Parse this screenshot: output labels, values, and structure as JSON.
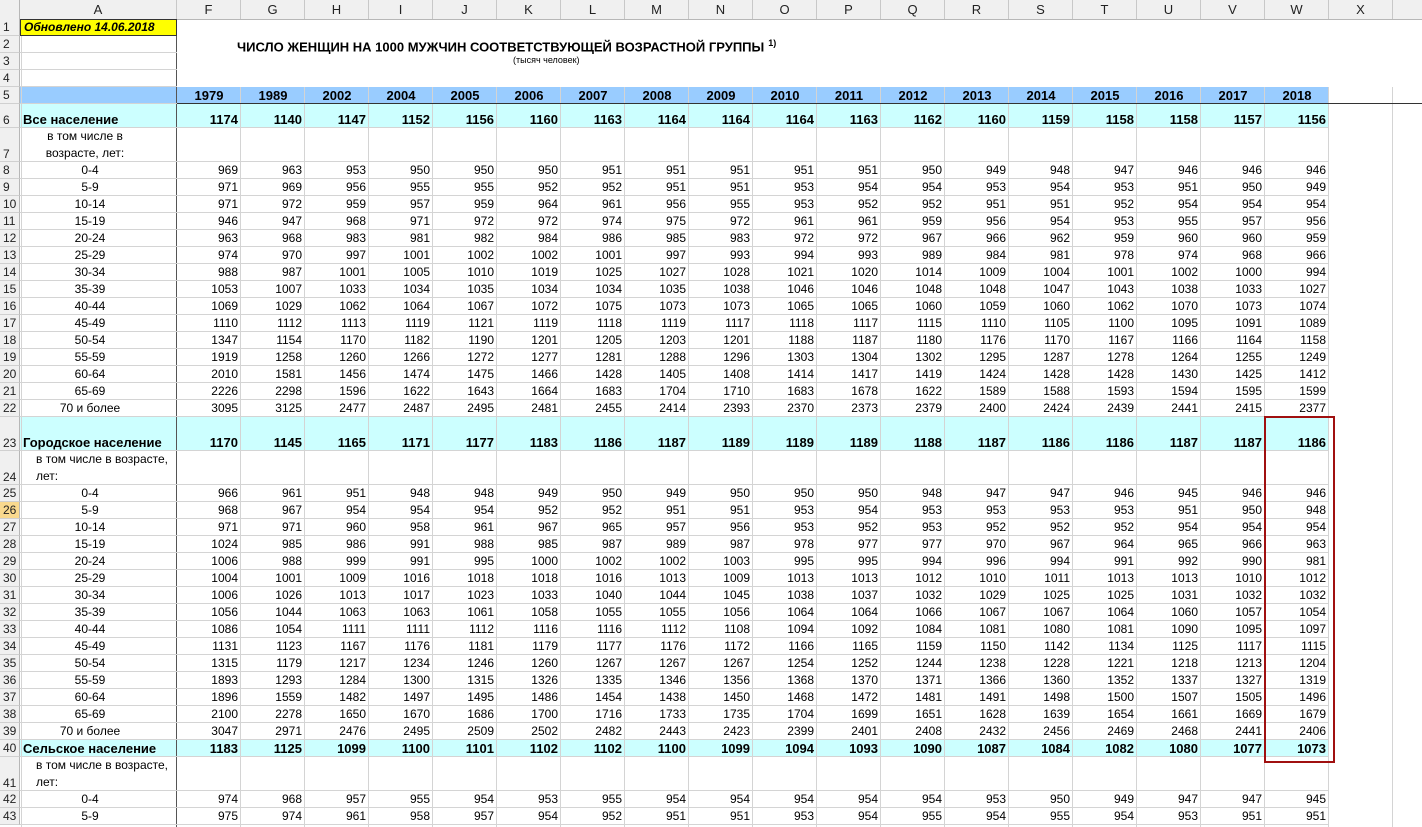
{
  "columns": [
    "A",
    "F",
    "G",
    "H",
    "I",
    "J",
    "K",
    "L",
    "M",
    "N",
    "O",
    "P",
    "Q",
    "R",
    "S",
    "T",
    "U",
    "V",
    "W",
    "X"
  ],
  "updated": "Обновлено 14.06.2018",
  "title": "ЧИСЛО ЖЕНЩИН НА 1000 МУЖЧИН СООТВЕТСТВУЮЩЕЙ ВОЗРАСТНОЙ ГРУППЫ",
  "title_note": "1)",
  "subtitle": "(тысяч человек)",
  "years": [
    "1979",
    "1989",
    "2002",
    "2004",
    "2005",
    "2006",
    "2007",
    "2008",
    "2009",
    "2010",
    "2011",
    "2012",
    "2013",
    "2014",
    "2015",
    "2016",
    "2017",
    "2018"
  ],
  "rows": [
    {
      "n": "6",
      "label": "Все население",
      "bold": true,
      "band": true,
      "values": [
        "1174",
        "1140",
        "1147",
        "1152",
        "1156",
        "1160",
        "1163",
        "1164",
        "1164",
        "1164",
        "1163",
        "1162",
        "1160",
        "1159",
        "1158",
        "1158",
        "1157",
        "1156"
      ]
    },
    {
      "n": "7",
      "label": "в том числе в возрасте, лет:",
      "subhead": true,
      "values": []
    },
    {
      "n": "8",
      "label": "0-4",
      "values": [
        "969",
        "963",
        "953",
        "950",
        "950",
        "950",
        "951",
        "951",
        "951",
        "951",
        "951",
        "950",
        "949",
        "948",
        "947",
        "946",
        "946",
        "946"
      ]
    },
    {
      "n": "9",
      "label": "5-9",
      "values": [
        "971",
        "969",
        "956",
        "955",
        "955",
        "952",
        "952",
        "951",
        "951",
        "953",
        "954",
        "954",
        "953",
        "954",
        "953",
        "951",
        "950",
        "949"
      ]
    },
    {
      "n": "10",
      "label": "10-14",
      "values": [
        "971",
        "972",
        "959",
        "957",
        "959",
        "964",
        "961",
        "956",
        "955",
        "953",
        "952",
        "952",
        "951",
        "951",
        "952",
        "954",
        "954",
        "954"
      ]
    },
    {
      "n": "11",
      "label": "15-19",
      "values": [
        "946",
        "947",
        "968",
        "971",
        "972",
        "972",
        "974",
        "975",
        "972",
        "961",
        "961",
        "959",
        "956",
        "954",
        "953",
        "955",
        "957",
        "956"
      ]
    },
    {
      "n": "12",
      "label": "20-24",
      "values": [
        "963",
        "968",
        "983",
        "981",
        "982",
        "984",
        "986",
        "985",
        "983",
        "972",
        "972",
        "967",
        "966",
        "962",
        "959",
        "960",
        "960",
        "959"
      ]
    },
    {
      "n": "13",
      "label": "25-29",
      "values": [
        "974",
        "970",
        "997",
        "1001",
        "1002",
        "1002",
        "1001",
        "997",
        "993",
        "994",
        "993",
        "989",
        "984",
        "981",
        "978",
        "974",
        "968",
        "966"
      ]
    },
    {
      "n": "14",
      "label": "30-34",
      "values": [
        "988",
        "987",
        "1001",
        "1005",
        "1010",
        "1019",
        "1025",
        "1027",
        "1028",
        "1021",
        "1020",
        "1014",
        "1009",
        "1004",
        "1001",
        "1002",
        "1000",
        "994"
      ]
    },
    {
      "n": "15",
      "label": "35-39",
      "values": [
        "1053",
        "1007",
        "1033",
        "1034",
        "1035",
        "1034",
        "1034",
        "1035",
        "1038",
        "1046",
        "1046",
        "1048",
        "1048",
        "1047",
        "1043",
        "1038",
        "1033",
        "1027"
      ]
    },
    {
      "n": "16",
      "label": "40-44",
      "values": [
        "1069",
        "1029",
        "1062",
        "1064",
        "1067",
        "1072",
        "1075",
        "1073",
        "1073",
        "1065",
        "1065",
        "1060",
        "1059",
        "1060",
        "1062",
        "1070",
        "1073",
        "1074"
      ]
    },
    {
      "n": "17",
      "label": "45-49",
      "values": [
        "1110",
        "1112",
        "1113",
        "1119",
        "1121",
        "1119",
        "1118",
        "1119",
        "1117",
        "1118",
        "1117",
        "1115",
        "1110",
        "1105",
        "1100",
        "1095",
        "1091",
        "1089"
      ]
    },
    {
      "n": "18",
      "label": "50-54",
      "values": [
        "1347",
        "1154",
        "1170",
        "1182",
        "1190",
        "1201",
        "1205",
        "1203",
        "1201",
        "1188",
        "1187",
        "1180",
        "1176",
        "1170",
        "1167",
        "1166",
        "1164",
        "1158"
      ]
    },
    {
      "n": "19",
      "label": "55-59",
      "values": [
        "1919",
        "1258",
        "1260",
        "1266",
        "1272",
        "1277",
        "1281",
        "1288",
        "1296",
        "1303",
        "1304",
        "1302",
        "1295",
        "1287",
        "1278",
        "1264",
        "1255",
        "1249"
      ]
    },
    {
      "n": "20",
      "label": "60-64",
      "values": [
        "2010",
        "1581",
        "1456",
        "1474",
        "1475",
        "1466",
        "1428",
        "1405",
        "1408",
        "1414",
        "1417",
        "1419",
        "1424",
        "1428",
        "1428",
        "1430",
        "1425",
        "1412"
      ]
    },
    {
      "n": "21",
      "label": "65-69",
      "values": [
        "2226",
        "2298",
        "1596",
        "1622",
        "1643",
        "1664",
        "1683",
        "1704",
        "1710",
        "1683",
        "1678",
        "1622",
        "1589",
        "1588",
        "1593",
        "1594",
        "1595",
        "1599"
      ]
    },
    {
      "n": "22",
      "label": "70 и более",
      "values": [
        "3095",
        "3125",
        "2477",
        "2487",
        "2495",
        "2481",
        "2455",
        "2414",
        "2393",
        "2370",
        "2373",
        "2379",
        "2400",
        "2424",
        "2439",
        "2441",
        "2415",
        "2377"
      ]
    },
    {
      "n": "23",
      "label": "Городское население",
      "bold": true,
      "band": true,
      "values": [
        "1170",
        "1145",
        "1165",
        "1171",
        "1177",
        "1183",
        "1186",
        "1187",
        "1189",
        "1189",
        "1189",
        "1188",
        "1187",
        "1186",
        "1186",
        "1187",
        "1187",
        "1186"
      ]
    },
    {
      "n": "24",
      "label": "в том числе в возрасте,  лет:",
      "subhead": true,
      "values": []
    },
    {
      "n": "25",
      "label": "0-4",
      "values": [
        "966",
        "961",
        "951",
        "948",
        "948",
        "949",
        "950",
        "949",
        "950",
        "950",
        "950",
        "948",
        "947",
        "947",
        "946",
        "945",
        "946",
        "946"
      ]
    },
    {
      "n": "26",
      "label": "5-9",
      "values": [
        "968",
        "967",
        "954",
        "954",
        "954",
        "952",
        "952",
        "951",
        "951",
        "953",
        "954",
        "953",
        "953",
        "953",
        "953",
        "951",
        "950",
        "948"
      ]
    },
    {
      "n": "27",
      "label": "10-14",
      "values": [
        "971",
        "971",
        "960",
        "958",
        "961",
        "967",
        "965",
        "957",
        "956",
        "953",
        "952",
        "953",
        "952",
        "952",
        "952",
        "954",
        "954",
        "954"
      ]
    },
    {
      "n": "28",
      "label": "15-19",
      "values": [
        "1024",
        "985",
        "986",
        "991",
        "988",
        "985",
        "987",
        "989",
        "987",
        "978",
        "977",
        "977",
        "970",
        "967",
        "964",
        "965",
        "966",
        "963"
      ]
    },
    {
      "n": "29",
      "label": "20-24",
      "values": [
        "1006",
        "988",
        "999",
        "991",
        "995",
        "1000",
        "1002",
        "1002",
        "1003",
        "995",
        "995",
        "994",
        "996",
        "994",
        "991",
        "992",
        "990",
        "981"
      ]
    },
    {
      "n": "30",
      "label": "25-29",
      "values": [
        "1004",
        "1001",
        "1009",
        "1016",
        "1018",
        "1018",
        "1016",
        "1013",
        "1009",
        "1013",
        "1013",
        "1012",
        "1010",
        "1011",
        "1013",
        "1013",
        "1010",
        "1012"
      ]
    },
    {
      "n": "31",
      "label": "30-34",
      "values": [
        "1006",
        "1026",
        "1013",
        "1017",
        "1023",
        "1033",
        "1040",
        "1044",
        "1045",
        "1038",
        "1037",
        "1032",
        "1029",
        "1025",
        "1025",
        "1031",
        "1032",
        "1032"
      ]
    },
    {
      "n": "32",
      "label": "35-39",
      "values": [
        "1056",
        "1044",
        "1063",
        "1063",
        "1061",
        "1058",
        "1055",
        "1055",
        "1056",
        "1064",
        "1064",
        "1066",
        "1067",
        "1067",
        "1064",
        "1060",
        "1057",
        "1054"
      ]
    },
    {
      "n": "33",
      "label": "40-44",
      "values": [
        "1086",
        "1054",
        "1111",
        "1111",
        "1112",
        "1116",
        "1116",
        "1112",
        "1108",
        "1094",
        "1092",
        "1084",
        "1081",
        "1080",
        "1081",
        "1090",
        "1095",
        "1097"
      ]
    },
    {
      "n": "34",
      "label": "45-49",
      "values": [
        "1131",
        "1123",
        "1167",
        "1176",
        "1181",
        "1179",
        "1177",
        "1176",
        "1172",
        "1166",
        "1165",
        "1159",
        "1150",
        "1142",
        "1134",
        "1125",
        "1117",
        "1115"
      ]
    },
    {
      "n": "35",
      "label": "50-54",
      "values": [
        "1315",
        "1179",
        "1217",
        "1234",
        "1246",
        "1260",
        "1267",
        "1267",
        "1267",
        "1254",
        "1252",
        "1244",
        "1238",
        "1228",
        "1221",
        "1218",
        "1213",
        "1204"
      ]
    },
    {
      "n": "36",
      "label": "55-59",
      "values": [
        "1893",
        "1293",
        "1284",
        "1300",
        "1315",
        "1326",
        "1335",
        "1346",
        "1356",
        "1368",
        "1370",
        "1371",
        "1366",
        "1360",
        "1352",
        "1337",
        "1327",
        "1319"
      ]
    },
    {
      "n": "37",
      "label": "60-64",
      "values": [
        "1896",
        "1559",
        "1482",
        "1497",
        "1495",
        "1486",
        "1454",
        "1438",
        "1450",
        "1468",
        "1472",
        "1481",
        "1491",
        "1498",
        "1500",
        "1507",
        "1505",
        "1496"
      ]
    },
    {
      "n": "38",
      "label": "65-69",
      "values": [
        "2100",
        "2278",
        "1650",
        "1670",
        "1686",
        "1700",
        "1716",
        "1733",
        "1735",
        "1704",
        "1699",
        "1651",
        "1628",
        "1639",
        "1654",
        "1661",
        "1669",
        "1679"
      ]
    },
    {
      "n": "39",
      "label": "70 и более",
      "values": [
        "3047",
        "2971",
        "2476",
        "2495",
        "2509",
        "2502",
        "2482",
        "2443",
        "2423",
        "2399",
        "2401",
        "2408",
        "2432",
        "2456",
        "2469",
        "2468",
        "2441",
        "2406"
      ]
    },
    {
      "n": "40",
      "label": "Сельское население",
      "bold": true,
      "band": true,
      "values": [
        "1183",
        "1125",
        "1099",
        "1100",
        "1101",
        "1102",
        "1102",
        "1100",
        "1099",
        "1094",
        "1093",
        "1090",
        "1087",
        "1084",
        "1082",
        "1080",
        "1077",
        "1073"
      ]
    },
    {
      "n": "41",
      "label": "в том числе в возрасте,  лет:",
      "subhead": true,
      "values": []
    },
    {
      "n": "42",
      "label": "0-4",
      "values": [
        "974",
        "968",
        "957",
        "955",
        "954",
        "953",
        "955",
        "954",
        "954",
        "954",
        "954",
        "954",
        "953",
        "950",
        "949",
        "947",
        "947",
        "945"
      ]
    },
    {
      "n": "43",
      "label": "5-9",
      "values": [
        "975",
        "974",
        "961",
        "958",
        "957",
        "954",
        "952",
        "951",
        "951",
        "953",
        "954",
        "955",
        "954",
        "955",
        "954",
        "953",
        "951",
        "951"
      ]
    }
  ],
  "header_rows": [
    "1",
    "2",
    "3",
    "4",
    "5"
  ],
  "selected_row": "26",
  "colors": {
    "band": "#ccffff",
    "header_band": "#99ccff",
    "updated_bg": "#ffff00",
    "selection": "#a01010"
  }
}
